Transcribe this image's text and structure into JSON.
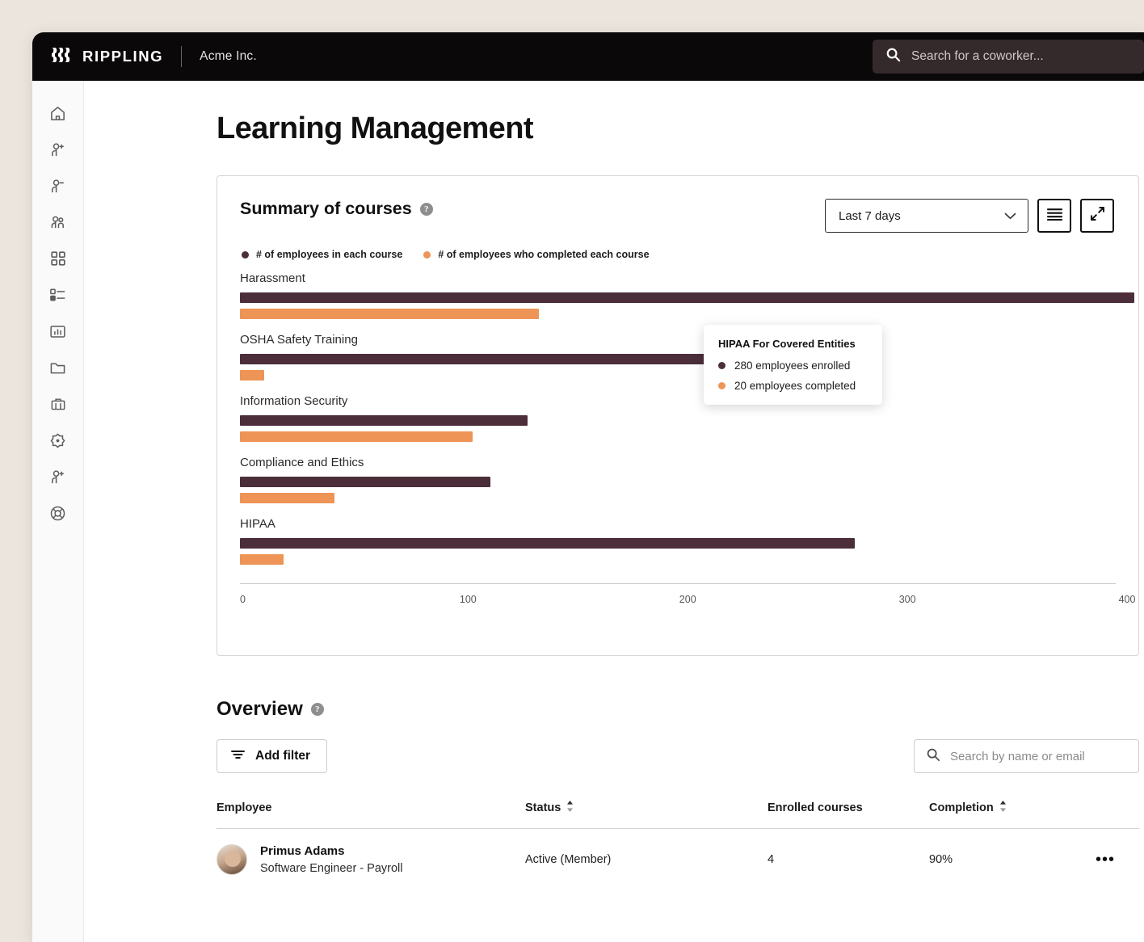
{
  "header": {
    "brand": "RIPPLING",
    "company": "Acme Inc.",
    "search_placeholder": "Search for a coworker...",
    "search_value": ""
  },
  "sidebar": {
    "items": [
      {
        "icon": "home-icon",
        "name": "home"
      },
      {
        "icon": "user-add-icon",
        "name": "hire"
      },
      {
        "icon": "user-remove-icon",
        "name": "terminate"
      },
      {
        "icon": "people-icon",
        "name": "people"
      },
      {
        "icon": "apps-grid-icon",
        "name": "apps"
      },
      {
        "icon": "list-icon",
        "name": "tasks"
      },
      {
        "icon": "report-chart-icon",
        "name": "reports"
      },
      {
        "icon": "folder-icon",
        "name": "documents"
      },
      {
        "icon": "briefcase-icon",
        "name": "benefits"
      },
      {
        "icon": "target-icon",
        "name": "goals"
      },
      {
        "icon": "user-add-icon",
        "name": "recruiting"
      },
      {
        "icon": "lifebuoy-icon",
        "name": "support"
      }
    ]
  },
  "page": {
    "title": "Learning Management"
  },
  "chart_card": {
    "title": "Summary of courses",
    "help_glyph": "?",
    "date_range": "Last 7 days",
    "chevron": "⌄",
    "list_view_button": "list-view",
    "expand_button": "expand"
  },
  "chart_data": {
    "type": "bar",
    "orientation": "horizontal",
    "title": "Summary of courses",
    "categories": [
      "Harassment",
      "OSHA Safety Training",
      "Information Security",
      "Compliance and Ethics",
      "HIPAA"
    ],
    "series": [
      {
        "name": "# of employees in each course",
        "color": "#4b2e3a",
        "values": [
          407,
          281,
          131,
          114,
          280
        ]
      },
      {
        "name": "# of employees who completed each course",
        "color": "#ee9456",
        "values": [
          136,
          11,
          106,
          43,
          20
        ]
      }
    ],
    "xlabel": "",
    "ylabel": "",
    "xlim": [
      0,
      420
    ],
    "xticks": [
      0,
      100,
      200,
      300,
      400
    ],
    "xtick_labels": [
      "0",
      "100",
      "200",
      "300",
      "400"
    ],
    "grid": false,
    "legend_position": "top-left"
  },
  "tooltip": {
    "title": "HIPAA For Covered Entities",
    "rows": [
      {
        "text": "280 employees enrolled",
        "color": "#4b2e3a"
      },
      {
        "text": "20 employees completed",
        "color": "#ee9456"
      }
    ]
  },
  "overview": {
    "title": "Overview",
    "help_glyph": "?",
    "add_filter_label": "Add filter",
    "search_placeholder": "Search by name or email",
    "search_value": "",
    "columns": [
      "Employee",
      "Status",
      "Enrolled courses",
      "Completion"
    ],
    "rows": [
      {
        "name": "Primus Adams",
        "role": "Software Engineer - Payroll",
        "status": "Active (Member)",
        "enrolled_courses": "4",
        "completion": "90%",
        "actions": "•••"
      }
    ]
  }
}
